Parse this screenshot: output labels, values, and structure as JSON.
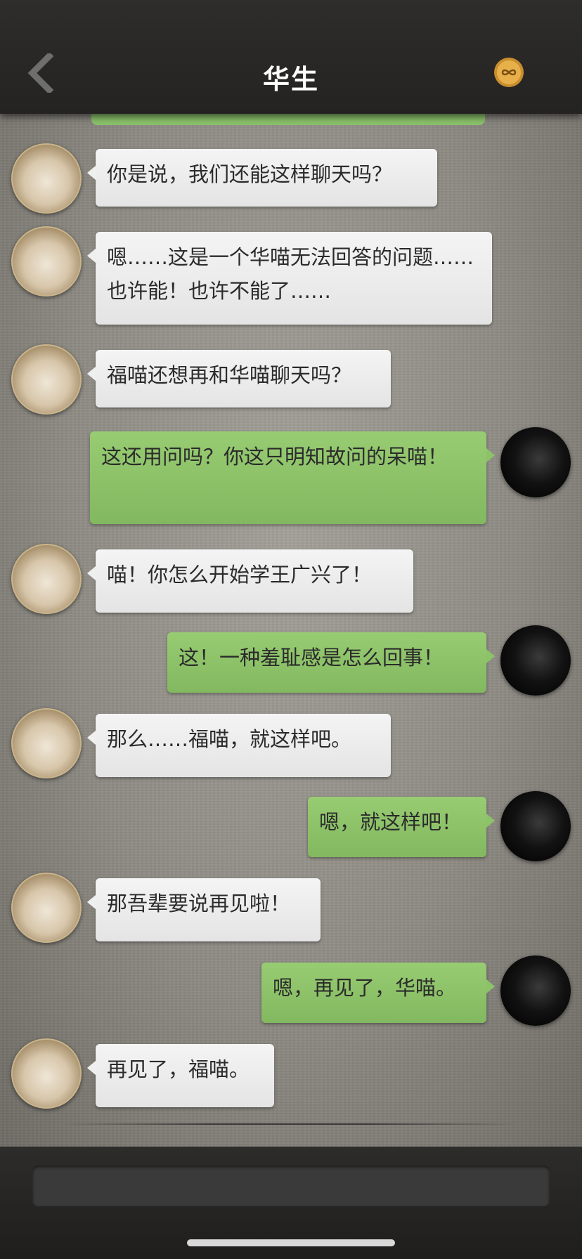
{
  "header": {
    "title": "华生",
    "back_icon": "chevron-left-icon",
    "badge_icon": "infinity-coin-icon"
  },
  "messages": [
    {
      "side": "left",
      "text": "你是说，我们还能这样聊天吗？"
    },
    {
      "side": "left",
      "text": "嗯……这是一个华喵无法回答的问题……也许能！也许不能了……"
    },
    {
      "side": "left",
      "text": "福喵还想再和华喵聊天吗？"
    },
    {
      "side": "right",
      "text": "这还用问吗？你这只明知故问的呆喵！"
    },
    {
      "side": "left",
      "text": "喵！你怎么开始学王广兴了！"
    },
    {
      "side": "right",
      "text": "这！一种羞耻感是怎么回事！"
    },
    {
      "side": "left",
      "text": "那么……福喵，就这样吧。"
    },
    {
      "side": "right",
      "text": "嗯，就这样吧！"
    },
    {
      "side": "left",
      "text": "那吾辈要说再见啦！"
    },
    {
      "side": "right",
      "text": "嗯，再见了，华喵。"
    },
    {
      "side": "left",
      "text": "再见了，福喵。"
    }
  ],
  "colors": {
    "header": "#2a2927",
    "bubble_green": "#8cc268",
    "bubble_white": "#efefef",
    "badge_gold": "#d9a441"
  }
}
